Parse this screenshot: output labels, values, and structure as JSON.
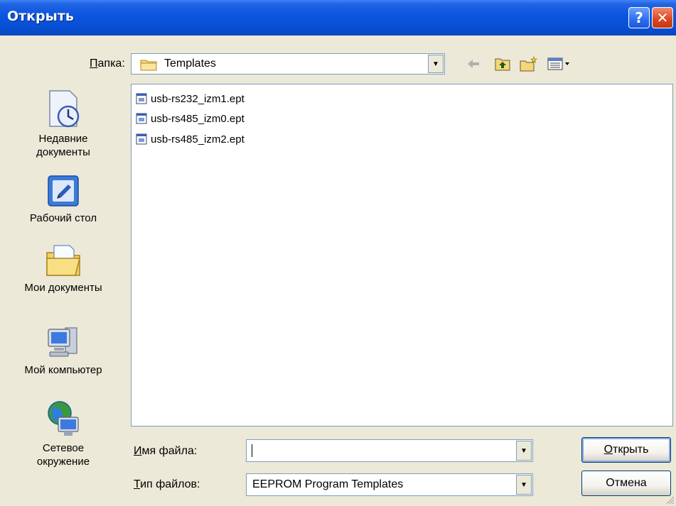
{
  "window": {
    "title": "Открыть"
  },
  "titlebar": {
    "help_glyph": "?",
    "close_glyph": "✕"
  },
  "lookin": {
    "label_hotkey": "П",
    "label_rest": "апка:",
    "value": "Templates"
  },
  "places": [
    {
      "label_line1": "Недавние",
      "label_line2": "документы",
      "icon": "recent-documents-icon"
    },
    {
      "label_line1": "Рабочий стол",
      "label_line2": "",
      "icon": "desktop-icon"
    },
    {
      "label_line1": "Мои документы",
      "label_line2": "",
      "icon": "my-documents-icon"
    },
    {
      "label_line1": "Мой компьютер",
      "label_line2": "",
      "icon": "my-computer-icon"
    },
    {
      "label_line1": "Сетевое",
      "label_line2": "окружение",
      "icon": "network-icon"
    }
  ],
  "files": [
    {
      "name": "usb-rs232_izm1.ept"
    },
    {
      "name": "usb-rs485_izm0.ept"
    },
    {
      "name": "usb-rs485_izm2.ept"
    }
  ],
  "filename": {
    "label_hotkey": "И",
    "label_rest": "мя файла:",
    "value": ""
  },
  "filetype": {
    "label_hotkey": "Т",
    "label_rest": "ип файлов:",
    "value": "EEPROM Program Templates"
  },
  "buttons": {
    "open_hotkey": "О",
    "open_rest": "ткрыть",
    "cancel": "Отмена"
  },
  "colors": {
    "titlebar": "#0a54e0",
    "face": "#ece9d8",
    "border": "#7f9db9",
    "close": "#d9461e"
  }
}
